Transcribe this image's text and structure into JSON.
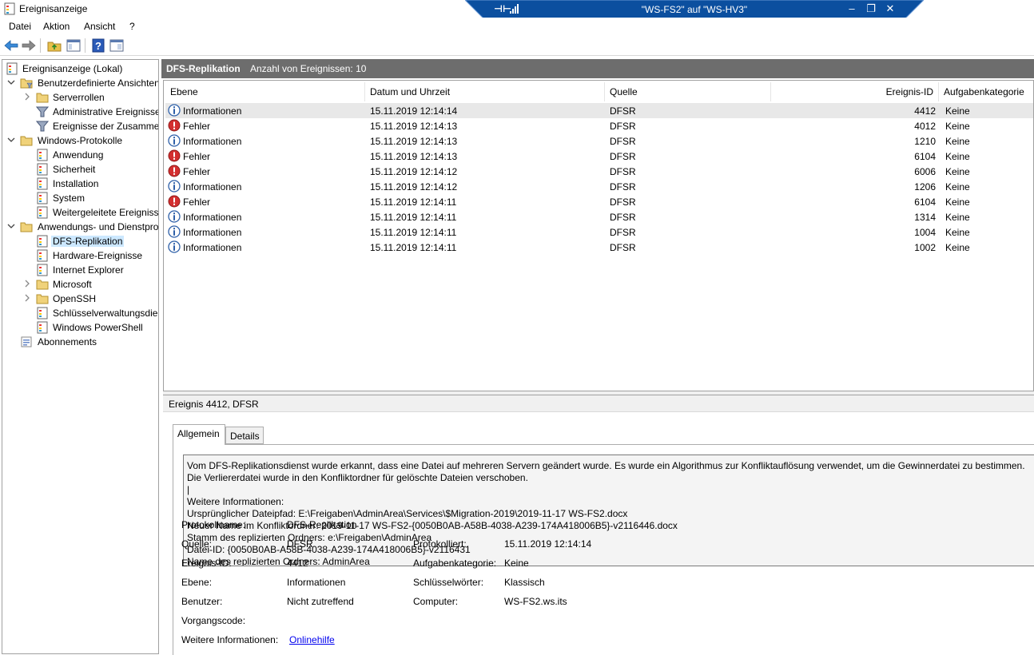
{
  "window": {
    "title": "Ereignisanzeige",
    "remote_title": "\"WS-FS2\" auf \"WS-HV3\"",
    "remote_bg": "#0b4f9f"
  },
  "menu": [
    "Datei",
    "Aktion",
    "Ansicht",
    "?"
  ],
  "tree": {
    "root": "Ereignisanzeige (Lokal)",
    "custom_views": "Benutzerdefinierte Ansichten",
    "server_roles": "Serverrollen",
    "admin_events": "Administrative Ereignisse",
    "summary_events": "Ereignisse der Zusammenfassung",
    "windows_logs": "Windows-Protokolle",
    "application": "Anwendung",
    "security": "Sicherheit",
    "setup": "Installation",
    "system": "System",
    "forwarded": "Weitergeleitete Ereignisse",
    "apps_services": "Anwendungs- und Dienstprotokolle",
    "dfs": "DFS-Replikation",
    "hardware": "Hardware-Ereignisse",
    "ie": "Internet Explorer",
    "microsoft": "Microsoft",
    "openssh": "OpenSSH",
    "keymgmt": "Schlüsselverwaltungsdienst",
    "powershell": "Windows PowerShell",
    "subscriptions": "Abonnements"
  },
  "log": {
    "name": "DFS-Replikation",
    "count": "Anzahl von Ereignissen: 10"
  },
  "table": {
    "headers": {
      "level": "Ebene",
      "datetime": "Datum und Uhrzeit",
      "source": "Quelle",
      "event_id": "Ereignis-ID",
      "category": "Aufgabenkategorie"
    },
    "rows": [
      {
        "type": "info",
        "level": "Informationen",
        "datetime": "15.11.2019 12:14:14",
        "source": "DFSR",
        "event_id": "4412",
        "category": "Keine"
      },
      {
        "type": "error",
        "level": "Fehler",
        "datetime": "15.11.2019 12:14:13",
        "source": "DFSR",
        "event_id": "4012",
        "category": "Keine"
      },
      {
        "type": "info",
        "level": "Informationen",
        "datetime": "15.11.2019 12:14:13",
        "source": "DFSR",
        "event_id": "1210",
        "category": "Keine"
      },
      {
        "type": "error",
        "level": "Fehler",
        "datetime": "15.11.2019 12:14:13",
        "source": "DFSR",
        "event_id": "6104",
        "category": "Keine"
      },
      {
        "type": "error",
        "level": "Fehler",
        "datetime": "15.11.2019 12:14:12",
        "source": "DFSR",
        "event_id": "6006",
        "category": "Keine"
      },
      {
        "type": "info",
        "level": "Informationen",
        "datetime": "15.11.2019 12:14:12",
        "source": "DFSR",
        "event_id": "1206",
        "category": "Keine"
      },
      {
        "type": "error",
        "level": "Fehler",
        "datetime": "15.11.2019 12:14:11",
        "source": "DFSR",
        "event_id": "6104",
        "category": "Keine"
      },
      {
        "type": "info",
        "level": "Informationen",
        "datetime": "15.11.2019 12:14:11",
        "source": "DFSR",
        "event_id": "1314",
        "category": "Keine"
      },
      {
        "type": "info",
        "level": "Informationen",
        "datetime": "15.11.2019 12:14:11",
        "source": "DFSR",
        "event_id": "1004",
        "category": "Keine"
      },
      {
        "type": "info",
        "level": "Informationen",
        "datetime": "15.11.2019 12:14:11",
        "source": "DFSR",
        "event_id": "1002",
        "category": "Keine"
      }
    ]
  },
  "detail": {
    "title": "Ereignis 4412, DFSR",
    "tabs": {
      "general": "Allgemein",
      "details": "Details"
    },
    "description": {
      "intro": "Vom DFS-Replikationsdienst wurde erkannt, dass eine Datei auf mehreren Servern geändert wurde. Es wurde ein Algorithmus zur Konfliktauflösung verwendet, um die Gewinnerdatei zu bestimmen. Die Verliererdatei wurde in den Konfliktordner für gelöschte Dateien verschoben.",
      "more": "Weitere Informationen:",
      "orig_path": "Ursprünglicher Dateipfad: E:\\Freigaben\\AdminArea\\Services\\$Migration-2019\\2019-11-17 WS-FS2.docx",
      "new_name": "Neuer Name im Konfliktordner: 2019-11-17 WS-FS2-{0050B0AB-A58B-4038-A239-174A418006B5}-v2116446.docx",
      "root": "Stamm des replizierten Ordners: e:\\Freigaben\\AdminArea",
      "file_id": "Datei-ID: {0050B0AB-A58B-4038-A239-174A418006B5}-v2116431",
      "folder_name": "Name des replizierten Ordners: AdminArea"
    },
    "labels": {
      "log_name": "Protokollname:",
      "source": "Quelle:",
      "logged": "Protokolliert:",
      "event_id": "Ereignis-ID:",
      "category": "Aufgabenkategorie:",
      "level": "Ebene:",
      "keywords": "Schlüsselwörter:",
      "user": "Benutzer:",
      "computer": "Computer:",
      "opcode": "Vorgangscode:",
      "more_info": "Weitere Informationen:"
    },
    "values": {
      "log_name": "DFS-Replikation",
      "source": "DFSR",
      "logged": "15.11.2019 12:14:14",
      "event_id": "4412",
      "category": "Keine",
      "level": "Informationen",
      "keywords": "Klassisch",
      "user": "Nicht zutreffend",
      "computer": "WS-FS2.ws.its",
      "more_info_link": "Onlinehilfe"
    }
  }
}
